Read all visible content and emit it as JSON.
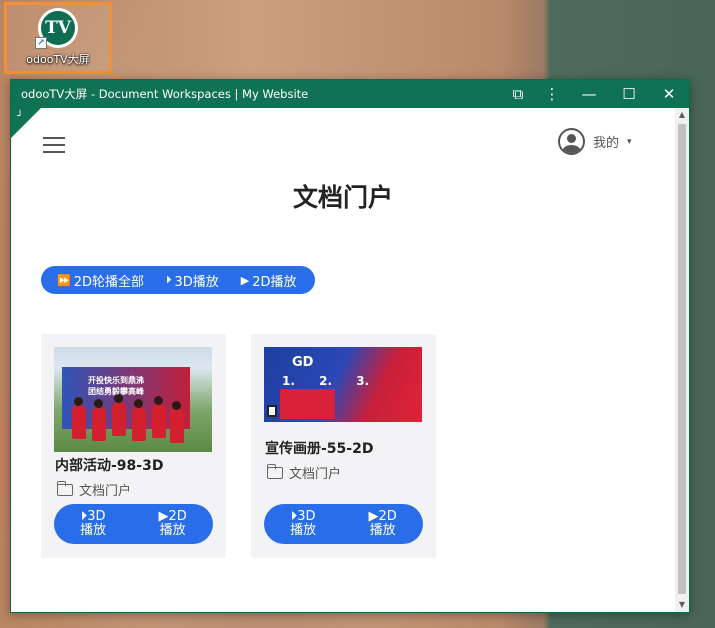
{
  "desktop": {
    "icon": {
      "logo_text": "TV",
      "label": "odooTV大屏"
    }
  },
  "window": {
    "title": "odooTV大屏 - Document Workspaces | My Website",
    "controls": {
      "extension": "⧉",
      "more": "⋮",
      "minimize": "—",
      "maximize": "☐",
      "close": "✕"
    }
  },
  "header": {
    "user_label": "我的",
    "caret": "▾"
  },
  "page": {
    "title": "文档门户"
  },
  "toolbar": {
    "buttons": [
      {
        "icon": "⏩",
        "label": "2D轮播全部"
      },
      {
        "icon": "⏵",
        "label": "3D播放"
      },
      {
        "icon": "▶",
        "label": "2D播放"
      }
    ]
  },
  "cards": [
    {
      "title": "内部活动-98-3D",
      "folder": "文档门户",
      "image_text": "开投快乐到鼎沸\n团结勇毅攀高峰",
      "actions": [
        {
          "icon": "⏵",
          "line1": "3D",
          "line2": "播放"
        },
        {
          "icon": "▶",
          "line1": "2D",
          "line2": "播放"
        }
      ]
    },
    {
      "title": "宣传画册-55-2D",
      "folder": "文档门户",
      "image_text": {
        "logo": "GD",
        "nums": [
          "1.",
          "2.",
          "3."
        ]
      },
      "actions": [
        {
          "icon": "⏵",
          "line1": "3D",
          "line2": "播放"
        },
        {
          "icon": "▶",
          "line1": "2D",
          "line2": "播放"
        }
      ]
    }
  ],
  "colors": {
    "titlebar": "#0f7253",
    "accent_blue": "#2a6de8",
    "highlight_orange": "#f0903c"
  }
}
